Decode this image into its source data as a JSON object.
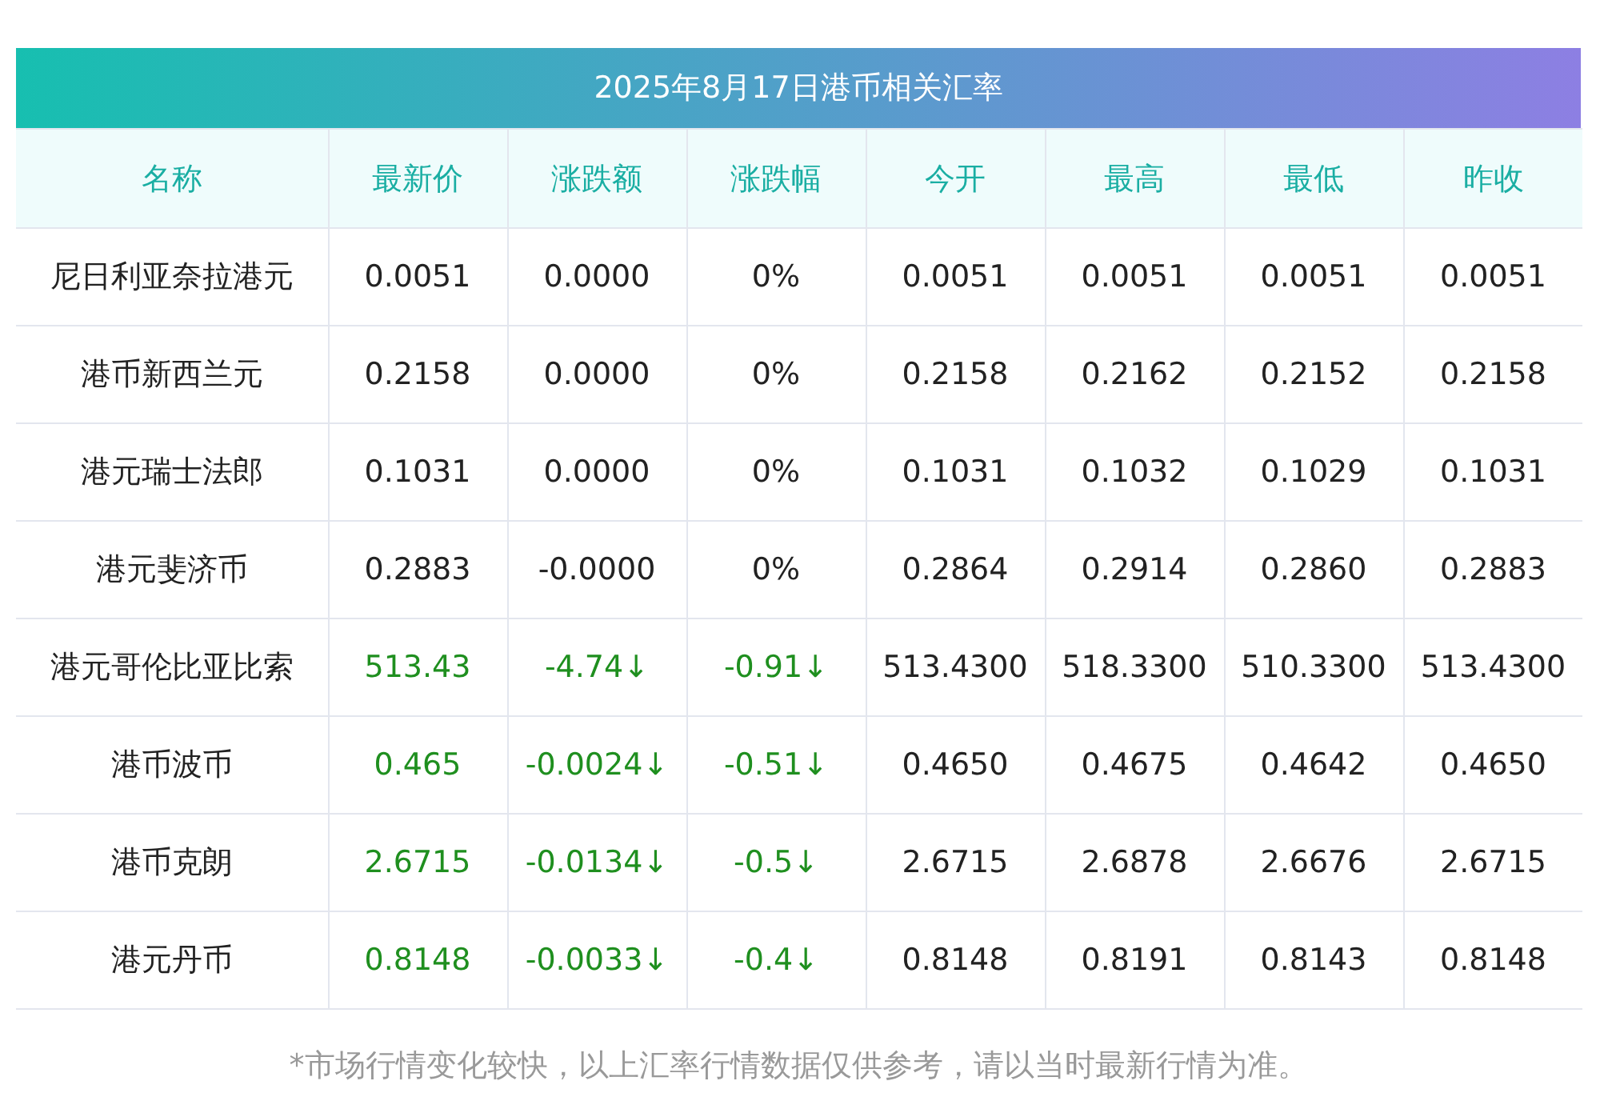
{
  "title": "2025年8月17日港币相关汇率",
  "columns": [
    "名称",
    "最新价",
    "涨跌额",
    "涨跌幅",
    "今开",
    "最高",
    "最低",
    "昨收"
  ],
  "rows": [
    {
      "falling": false,
      "cells": [
        "尼日利亚奈拉港元",
        "0.0051",
        "0.0000",
        "0%",
        "0.0051",
        "0.0051",
        "0.0051",
        "0.0051"
      ]
    },
    {
      "falling": false,
      "cells": [
        "港币新西兰元",
        "0.2158",
        "0.0000",
        "0%",
        "0.2158",
        "0.2162",
        "0.2152",
        "0.2158"
      ]
    },
    {
      "falling": false,
      "cells": [
        "港元瑞士法郎",
        "0.1031",
        "0.0000",
        "0%",
        "0.1031",
        "0.1032",
        "0.1029",
        "0.1031"
      ]
    },
    {
      "falling": false,
      "cells": [
        "港元斐济币",
        "0.2883",
        "-0.0000",
        "0%",
        "0.2864",
        "0.2914",
        "0.2860",
        "0.2883"
      ]
    },
    {
      "falling": true,
      "cells": [
        "港元哥伦比亚比索",
        "513.43",
        "-4.74↓",
        "-0.91↓",
        "513.4300",
        "518.3300",
        "510.3300",
        "513.4300"
      ]
    },
    {
      "falling": true,
      "cells": [
        "港币波币",
        "0.465",
        "-0.0024↓",
        "-0.51↓",
        "0.4650",
        "0.4675",
        "0.4642",
        "0.4650"
      ]
    },
    {
      "falling": true,
      "cells": [
        "港币克朗",
        "2.6715",
        "-0.0134↓",
        "-0.5↓",
        "2.6715",
        "2.6878",
        "2.6676",
        "2.6715"
      ]
    },
    {
      "falling": true,
      "cells": [
        "港元丹币",
        "0.8148",
        "-0.0033↓",
        "-0.4↓",
        "0.8148",
        "0.8191",
        "0.8143",
        "0.8148"
      ]
    }
  ],
  "footnote": "*市场行情变化较快，以上汇率行情数据仅供参考，请以当时最新行情为准。"
}
